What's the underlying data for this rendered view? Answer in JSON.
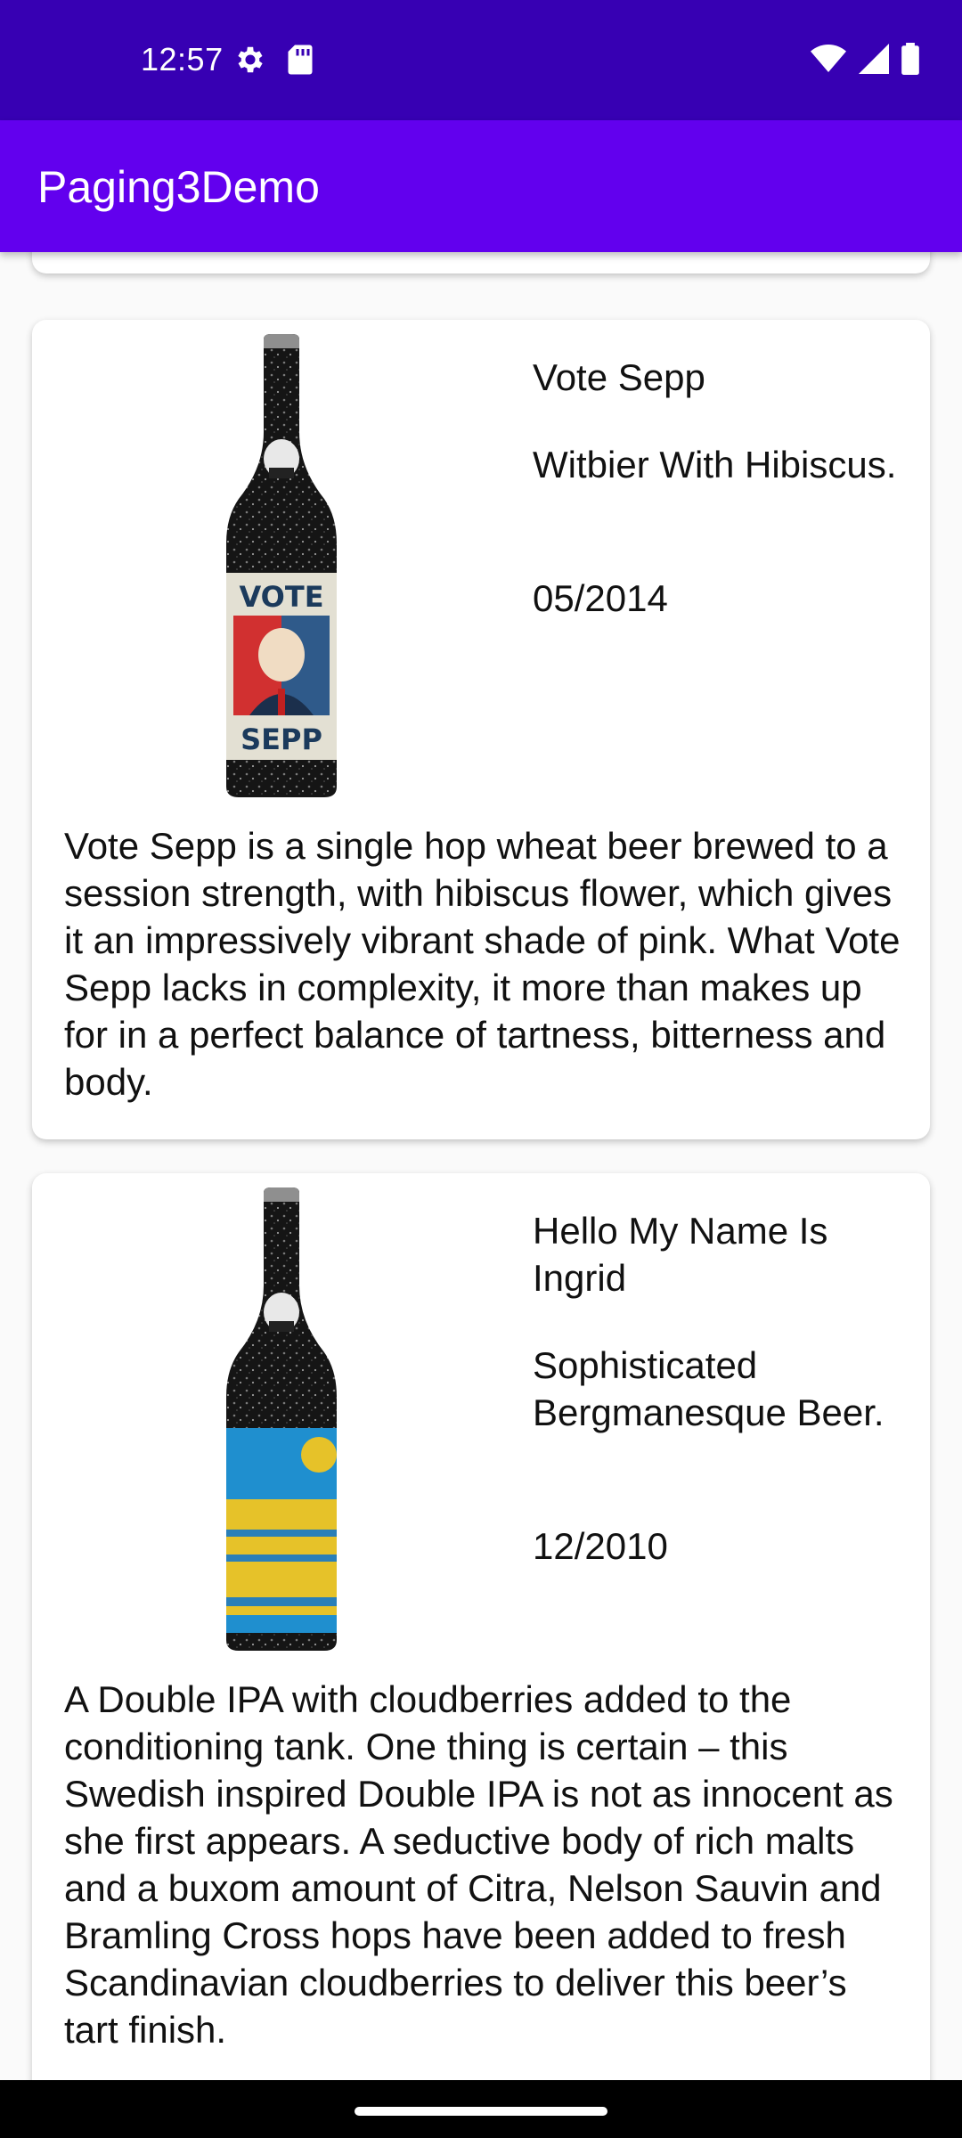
{
  "status_bar": {
    "time": "12:57",
    "left_icons": [
      "settings-icon",
      "sd-card-icon"
    ],
    "right_icons": [
      "wifi-icon",
      "signal-icon",
      "battery-icon"
    ],
    "background": "#3700b3"
  },
  "app_bar": {
    "title": "Paging3Demo",
    "background": "#6200ee"
  },
  "beers": [
    {
      "name": "Vote Sepp",
      "tagline": "Witbier With Hibiscus.",
      "first_brewed": "05/2014",
      "description": "Vote Sepp is a single hop wheat beer brewed to a session strength, with hibiscus flower, which gives it an impressively vibrant shade of pink. What Vote Sepp lacks in complexity, it more than makes up for in a perfect balance of tartness, bitterness and body.",
      "label_text_top": "VOTE",
      "label_text_bottom": "SEPP"
    },
    {
      "name": "Hello My Name Is Ingrid",
      "tagline": "Sophisticated Bergmanesque Beer.",
      "first_brewed": "12/2010",
      "description": "A Double IPA with cloudberries added to the conditioning tank. One thing is certain – this Swedish inspired Double IPA is not as innocent as she first appears. A seductive body of rich malts and a buxom amount of Citra, Nelson Sauvin and Bramling Cross hops have been added to fresh Scandinavian cloudberries to deliver this beer’s tart finish."
    }
  ]
}
